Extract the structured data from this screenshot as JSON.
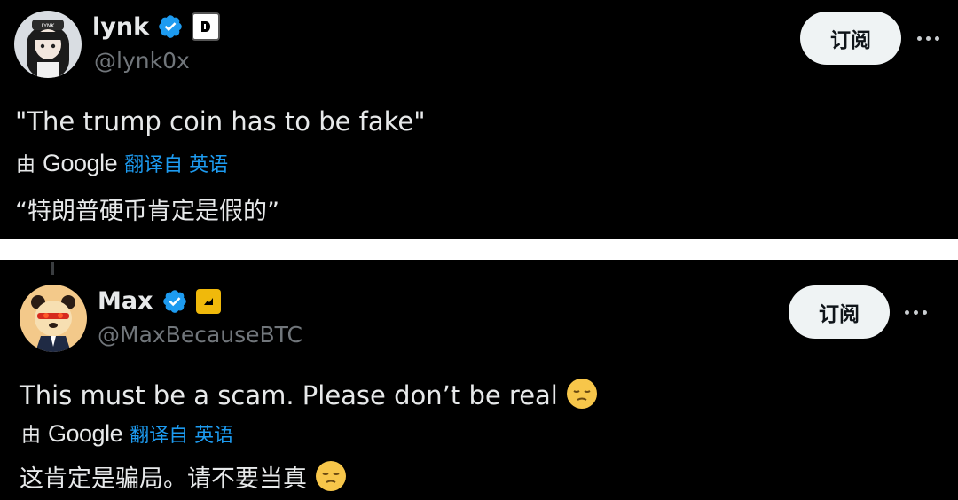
{
  "tweets": [
    {
      "display_name": "lynk",
      "handle": "@lynk0x",
      "subscribe_label": "订阅",
      "text": "\"The trump coin has to be fake\"",
      "translation": {
        "by": "由",
        "google": "Google",
        "from": "翻译自 英语",
        "text": "“特朗普硬币肯定是假的”"
      },
      "badge_icon": "square-d-icon"
    },
    {
      "display_name": "Max",
      "handle": "@MaxBecauseBTC",
      "subscribe_label": "订阅",
      "text": "This must be a scam. Please don’t be real",
      "translation": {
        "by": "由",
        "google": "Google",
        "from": "翻译自 英语",
        "text": "这肯定是骗局。请不要当真"
      },
      "badge_icon": "yellow-affiliate-icon",
      "emoji": "pensive-face-emoji"
    }
  ],
  "colors": {
    "background": "#000000",
    "text": "#e7e9ea",
    "muted": "#71767b",
    "link": "#1d9bf0",
    "verified": "#1d9bf0",
    "button_bg": "#eff3f4"
  }
}
